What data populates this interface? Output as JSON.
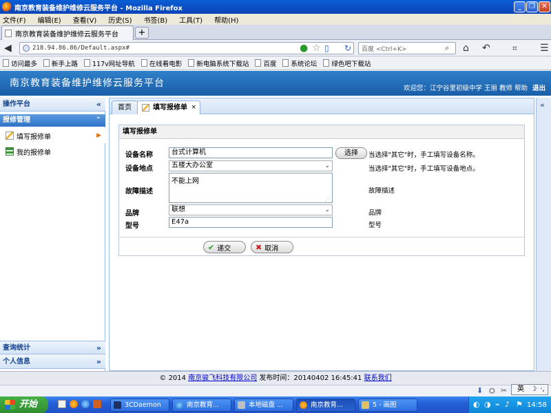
{
  "window": {
    "title": "南京教育装备维护维修云服务平台 - Mozilla Firefox"
  },
  "menu": [
    "文件(F)",
    "编辑(E)",
    "查看(V)",
    "历史(S)",
    "书签(B)",
    "工具(T)",
    "帮助(H)"
  ],
  "browser_tab": {
    "label": "南京教育装备维护维修云服务平台"
  },
  "nav": {
    "url": "218.94.86.86/Default.aspx#",
    "search_placeholder": "百度 <Ctrl+K>"
  },
  "bookmarks": [
    "访问最多",
    "新手上路",
    "117v网址导航",
    "在线看电影",
    "新电脑系统下载站",
    "百度",
    "系统论坛",
    "绿色吧下载站"
  ],
  "app": {
    "title": "南京教育装备维护维修云服务平台",
    "welcome": "欢迎您：江宁谷里初级中学 王丽 教师 帮助",
    "logout": "退出"
  },
  "sidebar": {
    "header": "操作平台",
    "group": "报修管理",
    "items": [
      "填写报修单",
      "我的报修单"
    ],
    "bottom": [
      "查询统计",
      "个人信息"
    ]
  },
  "tabs": {
    "home": "首页",
    "active": "填写报修单"
  },
  "form": {
    "title": "填写报修单",
    "device_name_label": "设备名称",
    "device_name_value": "台式计算机",
    "select_button": "选择",
    "device_name_hint": "当选择\"其它\"时，手工填写设备名称。",
    "location_label": "设备地点",
    "location_value": "五楼大办公室",
    "location_hint": "当选择\"其它\"时，手工填写设备地点。",
    "fault_label": "故障描述",
    "fault_value": "不能上网",
    "fault_hint": "故障描述",
    "brand_label": "品牌",
    "brand_value": "联想",
    "brand_hint": "品牌",
    "model_label": "型号",
    "model_value": "E47a",
    "model_hint": "型号",
    "submit": "递交",
    "cancel": "取消"
  },
  "footer": {
    "copyright": "© 2014",
    "company": "南京骏飞科技有限公司",
    "release": "发布时间：20140402 16:45:41",
    "contact": "联系我们"
  },
  "ime": "英",
  "taskbar": {
    "start": "开始",
    "items": [
      "3CDaemon",
      "南京教育...",
      "本地磁盘 ...",
      "南京教育...",
      "5 - 画图"
    ],
    "clock": "14:58"
  }
}
